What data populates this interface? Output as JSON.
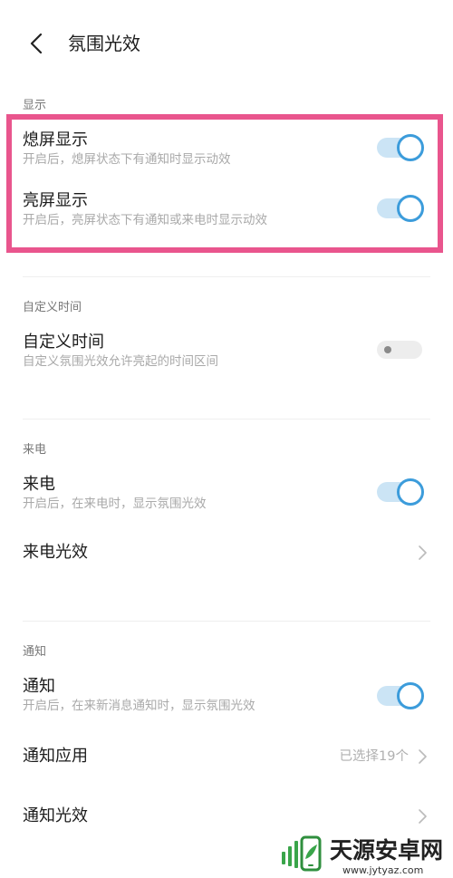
{
  "header": {
    "title": "氛围光效",
    "back_icon": "back-arrow-icon"
  },
  "sections": [
    {
      "label": "显示",
      "items": [
        {
          "title": "熄屏显示",
          "subtitle": "开启后，熄屏状态下有通知时显示动效",
          "toggle": true
        },
        {
          "title": "亮屏显示",
          "subtitle": "开启后，亮屏状态下有通知或来电时显示动效",
          "toggle": true
        }
      ]
    },
    {
      "label": "自定义时间",
      "items": [
        {
          "title": "自定义时间",
          "subtitle": "自定义氛围光效允许亮起的时间区间",
          "toggle": false
        }
      ]
    },
    {
      "label": "来电",
      "items": [
        {
          "title": "来电",
          "subtitle": "开启后，在来电时，显示氛围光效",
          "toggle": true
        },
        {
          "title": "来电光效",
          "icon": "chevron-right-icon"
        }
      ]
    },
    {
      "label": "通知",
      "items": [
        {
          "title": "通知",
          "subtitle": "开启后，在来新消息通知时，显示氛围光效",
          "toggle": true
        },
        {
          "title": "通知应用",
          "value": "已选择19个",
          "icon": "chevron-right-icon"
        },
        {
          "title": "通知光效",
          "icon": "chevron-right-icon"
        }
      ]
    }
  ],
  "watermark": {
    "name": "天源安卓网",
    "url": "www.jytyaz.com",
    "icon": "site-logo-icon"
  },
  "colors": {
    "accent": "#3c9cdb",
    "track_on": "#cbe4f5",
    "track_off": "#ededed",
    "highlight": "#e9558d",
    "logo_green": "#3aa54a"
  }
}
